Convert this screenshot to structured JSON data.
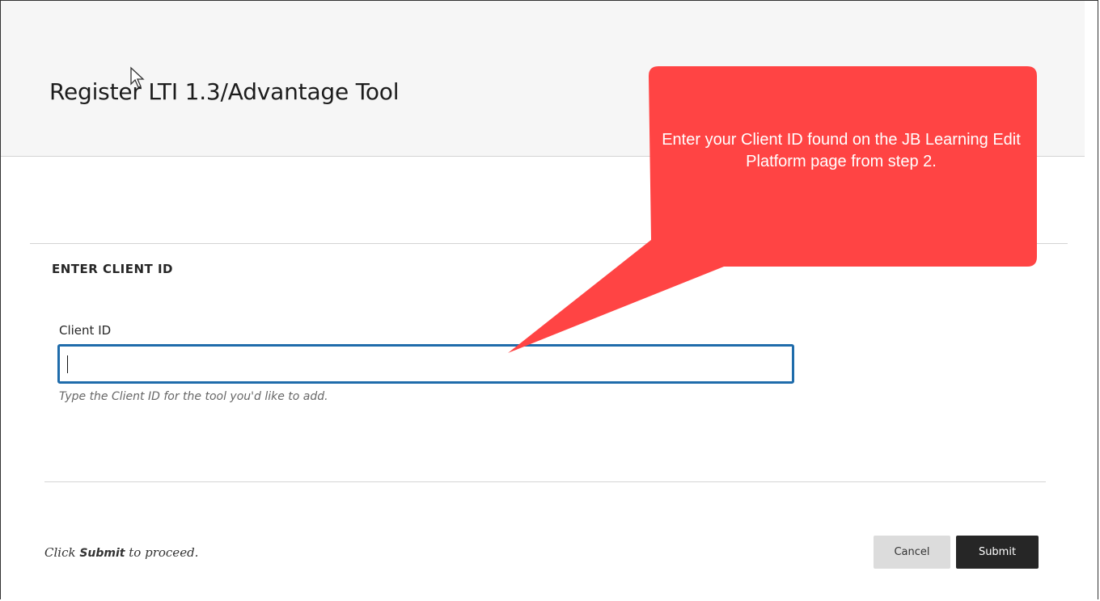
{
  "header": {
    "title": "Register LTI 1.3/Advantage Tool"
  },
  "form": {
    "section_heading": "ENTER CLIENT ID",
    "client_id_label": "Client ID",
    "client_id_value": "",
    "client_id_hint": "Type the Client ID for the tool you'd like to add."
  },
  "footer": {
    "instruction_prefix": "Click",
    "instruction_keyword": "Submit",
    "instruction_suffix": "to proceed.",
    "cancel_label": "Cancel",
    "submit_label": "Submit"
  },
  "callout": {
    "text": "Enter your Client ID found on the JB Learning Edit Platform page from step 2.",
    "color": "#ff4444"
  },
  "colors": {
    "input_focus_border": "#1f6cab",
    "submit_bg": "#262626",
    "cancel_bg": "#dcdcdc",
    "header_bg": "#f6f6f6"
  },
  "icons": {
    "cursor": "mouse-pointer-icon"
  }
}
